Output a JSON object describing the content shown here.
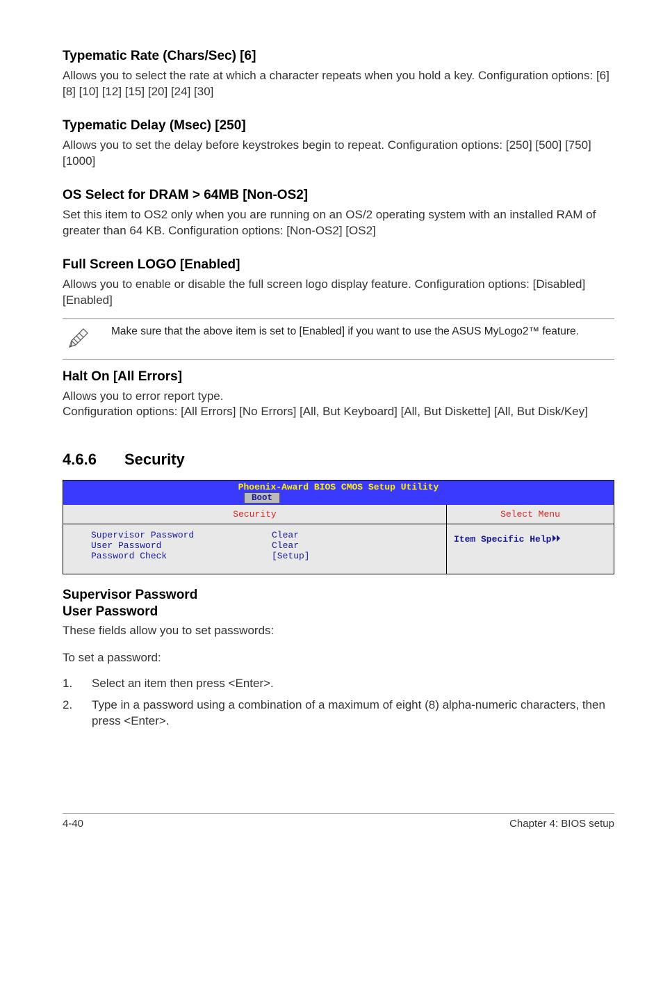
{
  "sections": {
    "typematic_rate": {
      "heading": "Typematic Rate (Chars/Sec) [6]",
      "body": "Allows you to select the rate at which a character repeats when you hold a key. Configuration options: [6] [8] [10] [12] [15] [20] [24] [30]"
    },
    "typematic_delay": {
      "heading": "Typematic Delay (Msec) [250]",
      "body": "Allows you to set the delay before keystrokes begin to repeat. Configuration options: [250] [500] [750] [1000]"
    },
    "os_select": {
      "heading": "OS Select for DRAM > 64MB [Non-OS2]",
      "body": "Set this item to OS2 only when you are running on an OS/2 operating system with an installed RAM of greater than 64 KB. Configuration options: [Non-OS2] [OS2]"
    },
    "full_screen_logo": {
      "heading": "Full Screen LOGO [Enabled]",
      "body": "Allows you to enable or disable the full screen logo display feature. Configuration options: [Disabled] [Enabled]"
    },
    "note": "Make sure that the above item is set to [Enabled] if you want to use the ASUS MyLogo2™ feature.",
    "halt_on": {
      "heading": "Halt On [All Errors]",
      "body": "Allows you to error report type.\nConfiguration options: [All Errors] [No Errors] [All, But Keyboard] [All, But Diskette] [All, But Disk/Key]"
    }
  },
  "security_section": {
    "number": "4.6.6",
    "title": "Security"
  },
  "bios": {
    "title": "Phoenix-Award BIOS CMOS Setup Utility",
    "tab": "Boot",
    "left_header": "Security",
    "right_header": "Select Menu",
    "rows": [
      {
        "label": "Supervisor Password",
        "value": "Clear"
      },
      {
        "label": "User Password",
        "value": "Clear"
      },
      {
        "label": "Password Check",
        "value": "[Setup]"
      }
    ],
    "help": "Item Specific Help"
  },
  "password_section": {
    "heading1": "Supervisor Password",
    "heading2": "User Password",
    "intro": "These fields allow you to set passwords:",
    "to_set": "To set a password:",
    "steps": [
      "Select an item then press <Enter>.",
      "Type in a password using a combination of a maximum of eight (8) alpha-numeric characters, then press <Enter>."
    ]
  },
  "footer": {
    "left": "4-40",
    "right": "Chapter 4: BIOS setup"
  }
}
